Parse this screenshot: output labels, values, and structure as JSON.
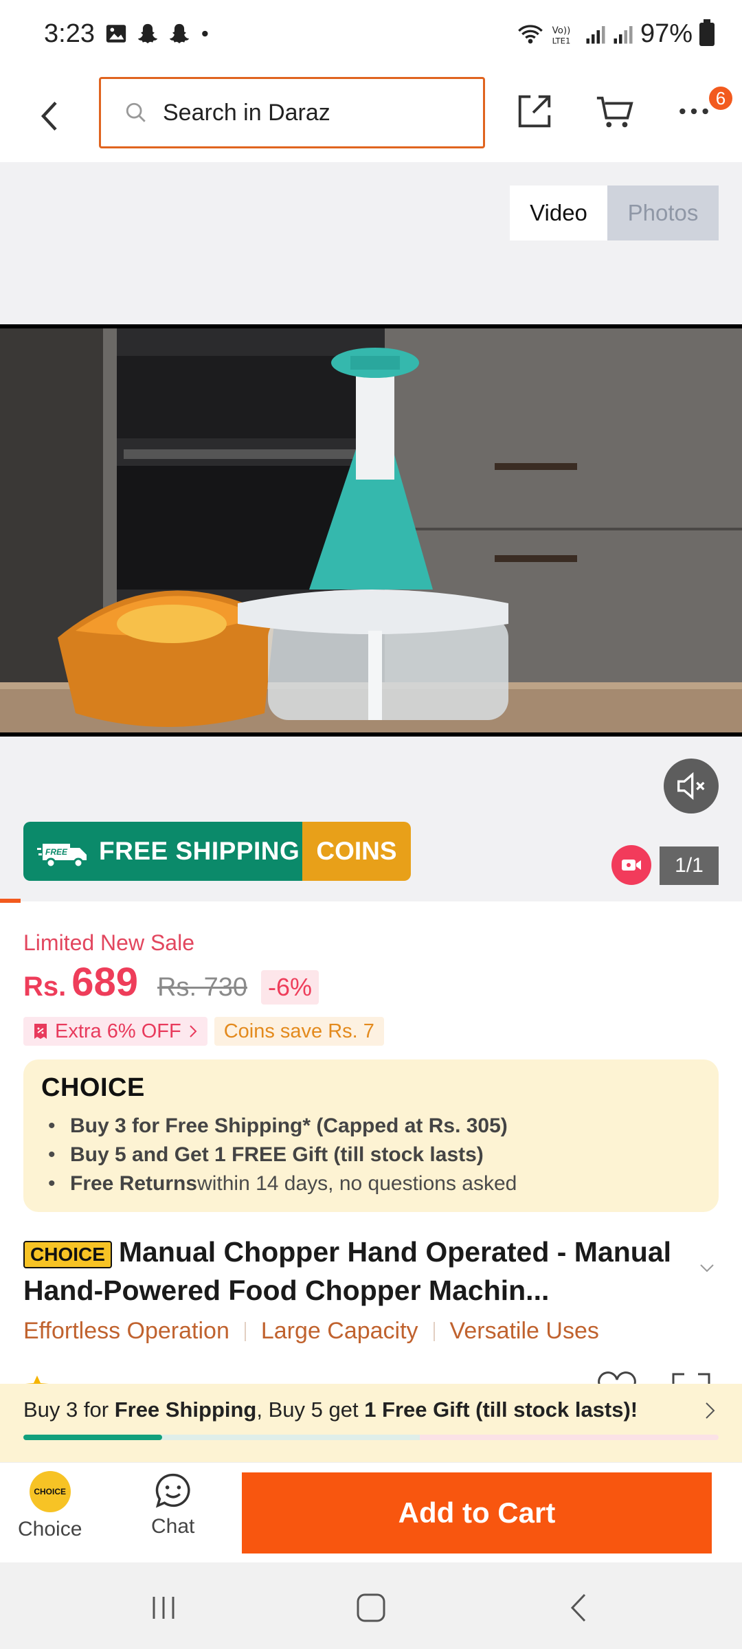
{
  "status_bar": {
    "time": "3:23",
    "battery": "97%",
    "icons_left": [
      "image-icon",
      "snapchat-icon",
      "snapchat-icon",
      "dot-icon"
    ],
    "icons_right": [
      "wifi-icon",
      "volte-icon",
      "signal-icon",
      "signal-icon",
      "battery-icon"
    ]
  },
  "header": {
    "search_placeholder": "Search in Daraz",
    "more_badge": "6"
  },
  "media": {
    "toggle_video": "Video",
    "toggle_photos": "Photos",
    "free_shipping": "FREE SHIPPING",
    "free_label": "FREE",
    "coins": "COINS",
    "counter": "1/1"
  },
  "price": {
    "label": "Limited New Sale",
    "currency": "Rs.",
    "current": "689",
    "original": "Rs. 730",
    "discount": "-6%",
    "extra_off": "Extra 6% OFF",
    "coins_save": "Coins save Rs. 7"
  },
  "choice": {
    "logo": "CHOICE",
    "items": [
      {
        "bold": "Buy 3 for  Free Shipping* (Capped at Rs. 305)",
        "rest": ""
      },
      {
        "bold": "Buy 5 and Get 1 FREE Gift (till stock lasts)",
        "rest": ""
      },
      {
        "bold": "Free Returns",
        "rest": " within 14 days, no questions asked"
      }
    ]
  },
  "product": {
    "badge": "CHOICE",
    "title": "Manual Chopper Hand Operated - Manual Hand-Powered Food Chopper Machin...",
    "features": [
      "Effortless Operation",
      "Large Capacity",
      "Versatile Uses"
    ]
  },
  "promo_banner": {
    "p1": "Buy 3 for ",
    "b1": "Free Shipping",
    "p2": ", Buy 5 get ",
    "b2": "1 Free Gift (till stock lasts)!",
    "progress": 0.2
  },
  "action_bar": {
    "choice_label": "Choice",
    "choice_logo": "CHOICE",
    "chat_label": "Chat",
    "add_to_cart": "Add to Cart"
  },
  "colors": {
    "brand_orange": "#f8560f",
    "price_red": "#ee3d5a",
    "free_shipping_green": "#0b8a6a",
    "coins_gold": "#e8a019",
    "choice_yellow": "#f7c325"
  }
}
